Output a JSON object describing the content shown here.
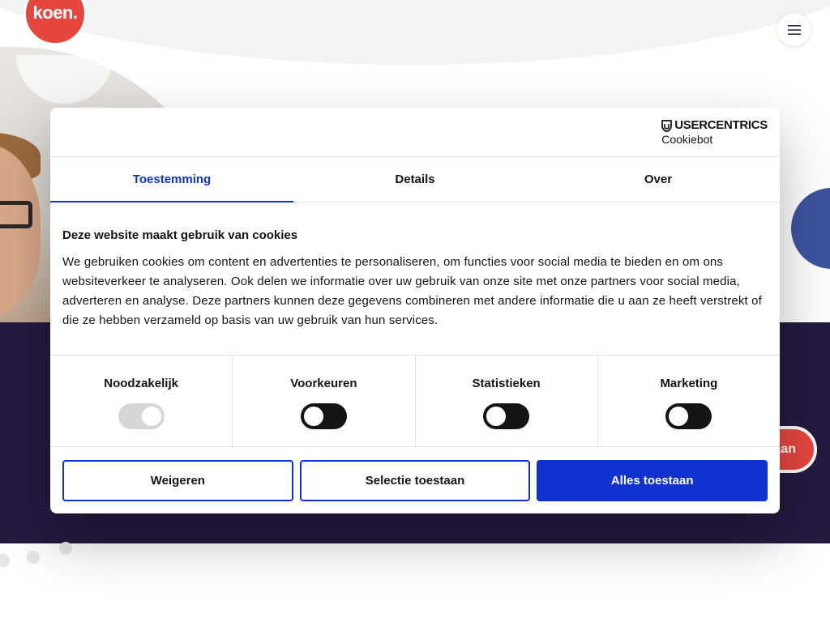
{
  "site": {
    "logo_text": "koen.",
    "cta_partial_label": "aan"
  },
  "colors": {
    "accent": "#1032cf",
    "brand_red": "#e5473f",
    "bg_purple": "#261a40",
    "bg_blue": "#3d55a0"
  },
  "icons": {
    "menu": "hamburger-icon",
    "brand": "shield-icon"
  },
  "dialog": {
    "brand_name": "USERCENTRICS",
    "brand_product": "Cookiebot",
    "tabs": [
      {
        "label": "Toestemming",
        "active": true
      },
      {
        "label": "Details",
        "active": false
      },
      {
        "label": "Over",
        "active": false
      }
    ],
    "title": "Deze website maakt gebruik van cookies",
    "text": "We gebruiken cookies om content en advertenties te personaliseren, om functies voor social media te bieden en om ons websiteverkeer te analyseren. Ook delen we informatie over uw gebruik van onze site met onze partners voor social media, adverteren en analyse. Deze partners kunnen deze gegevens combineren met andere informatie die u aan ze heeft verstrekt of die ze hebben verzameld op basis van uw gebruik van hun services.",
    "toggles": [
      {
        "label": "Noodzakelijk",
        "checked": true,
        "disabled": true
      },
      {
        "label": "Voorkeuren",
        "checked": false,
        "disabled": false
      },
      {
        "label": "Statistieken",
        "checked": false,
        "disabled": false
      },
      {
        "label": "Marketing",
        "checked": false,
        "disabled": false
      }
    ],
    "buttons": {
      "deny": "Weigeren",
      "allow_selection": "Selectie toestaan",
      "allow_all": "Alles toestaan"
    }
  }
}
